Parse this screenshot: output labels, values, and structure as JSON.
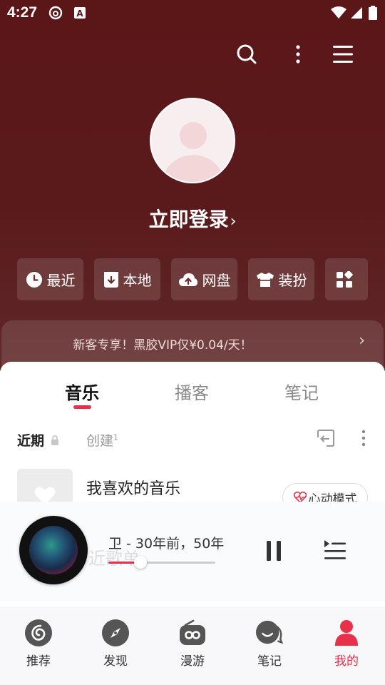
{
  "status": {
    "time": "4:27"
  },
  "profile": {
    "login_label": "立即登录",
    "login_chevron": "›"
  },
  "quick_actions": [
    {
      "label": "最近",
      "icon": "clock-icon"
    },
    {
      "label": "本地",
      "icon": "download-icon"
    },
    {
      "label": "网盘",
      "icon": "cloud-upload-icon"
    },
    {
      "label": "装扮",
      "icon": "shirt-icon"
    },
    {
      "label": "",
      "icon": "apps-grid-icon"
    }
  ],
  "vip_banner": {
    "text": "新客专享！黑胶VIP仅¥0.04/天！",
    "chevron": "›"
  },
  "tabs": [
    {
      "label": "音乐",
      "active": true
    },
    {
      "label": "播客",
      "active": false
    },
    {
      "label": "笔记",
      "active": false
    }
  ],
  "subtabs": {
    "recent": "近期",
    "created": "创建",
    "created_count": "1"
  },
  "playlist": {
    "title": "我喜欢的音乐",
    "heart_mode": "心动模式"
  },
  "player": {
    "song": "卫 - 30年前，50年",
    "progress_percent": 30,
    "ghost_text": "近歌单"
  },
  "nav": [
    {
      "label": "推荐",
      "icon": "netease-logo-icon",
      "active": false
    },
    {
      "label": "发现",
      "icon": "compass-icon",
      "active": false
    },
    {
      "label": "漫游",
      "icon": "radio-icon",
      "active": false
    },
    {
      "label": "笔记",
      "icon": "chat-bubble-icon",
      "active": false
    },
    {
      "label": "我的",
      "icon": "person-icon",
      "active": true
    }
  ],
  "colors": {
    "accent": "#e8304a",
    "hero": "#5a1a1b"
  }
}
